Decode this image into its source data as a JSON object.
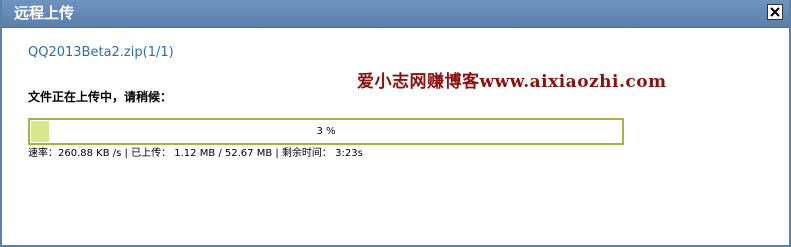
{
  "window": {
    "title": "远程上传",
    "close_icon": "close-x-icon"
  },
  "upload": {
    "file_name": "QQ2013Beta2.zip(1/1)",
    "status_text": "文件正在上传中，请稍候：",
    "progress_percent": 3,
    "progress_label": "3 %",
    "stats_line": "速率：260.88 KB /s | 已上传： 1.12 MB / 52.67 MB | 剩余时间： 3:23s"
  },
  "watermark": {
    "text": "爱小志网赚博客www.aixiaozhi.com"
  },
  "colors": {
    "titlebar": "#5a80aa",
    "file_name": "#2c6ea6",
    "progress_border": "#a3b53b",
    "progress_fill": "#d7e78c",
    "watermark": "#8b1010"
  }
}
